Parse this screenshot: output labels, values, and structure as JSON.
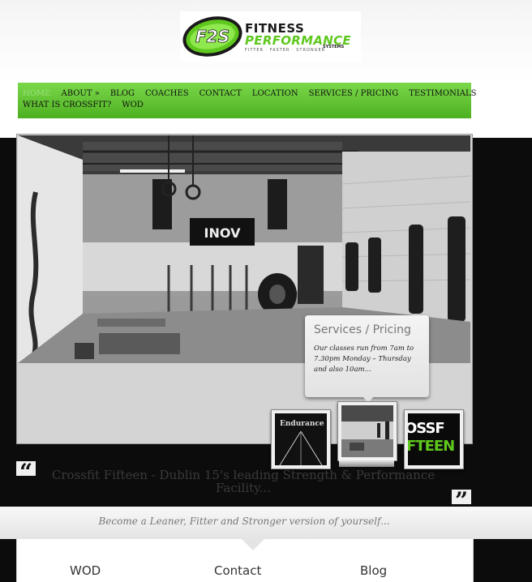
{
  "logo": {
    "monogram": "F2S",
    "line1": "FITNESS",
    "line2": "PERFORMANCE",
    "systems": "SYSTEMS",
    "tagline": "FITTER · FASTER · STRONGER"
  },
  "nav": {
    "row1": [
      "HOME",
      "ABOUT »",
      "BLOG",
      "COACHES",
      "CONTACT",
      "LOCATION",
      "SERVICES / PRICING",
      "TESTIMONIALS"
    ],
    "row2": [
      "WHAT IS CROSSFIT?",
      "WOD"
    ]
  },
  "slider": {
    "banner_text": "INOV",
    "caption_title": "Services / Pricing",
    "caption_body": "Our classes run from 7am to 7.30pm Monday – Thursday and also 10am...",
    "thumbnails": [
      {
        "text": "Endurance"
      },
      {
        "text": ""
      },
      {
        "text_top": "OSSF",
        "text_bottom": "FTEEN"
      }
    ]
  },
  "quote": {
    "open": "“",
    "close": "”",
    "text": "Crossfit Fifteen - Dublin 15's leading Strength & Performance Facility..."
  },
  "tagline": "Become a Leaner, Fitter and Stronger version of yourself...",
  "blocks": [
    "WOD",
    "Contact",
    "Blog"
  ],
  "colors": {
    "accent_green": "#5fc81e",
    "nav_green": "#6cc93b",
    "dark_band": "#0c0c0c"
  }
}
